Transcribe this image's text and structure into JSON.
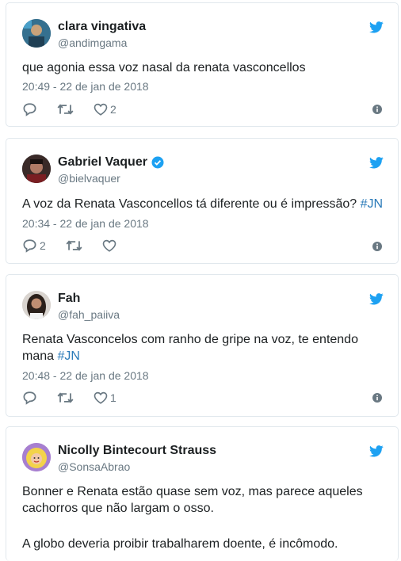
{
  "colors": {
    "brand": "#1da1f2",
    "link": "#2b7bb9",
    "muted": "#697882",
    "border": "#e1e8ed"
  },
  "tweets": [
    {
      "name": "clara vingativa",
      "handle": "@andimgama",
      "verified": false,
      "text": "que agonia essa voz nasal da renata vasconcellos",
      "time": "20:49 - 22 de jan de 2018",
      "replies": "",
      "likes": "2"
    },
    {
      "name": "Gabriel Vaquer",
      "handle": "@bielvaquer",
      "verified": true,
      "text": "A voz da Renata Vasconcellos tá diferente ou é impressão?",
      "hashtag": "#JN",
      "time": "20:34 - 22 de jan de 2018",
      "replies": "2",
      "likes": ""
    },
    {
      "name": "Fah",
      "handle": "@fah_paiiva",
      "verified": false,
      "text": "Renata Vasconcelos com ranho de gripe na voz, te entendo mana",
      "hashtag": "#JN",
      "time": "20:48 - 22 de jan de 2018",
      "replies": "",
      "likes": "1"
    },
    {
      "name": "Nicolly Bintecourt Strauss",
      "handle": "@SonsaAbrao",
      "verified": false,
      "text": "Bonner e Renata estão quase sem voz, mas parece aqueles cachorros que não largam o osso.",
      "text2": "A globo deveria proibir trabalharem doente, é incômodo."
    }
  ]
}
